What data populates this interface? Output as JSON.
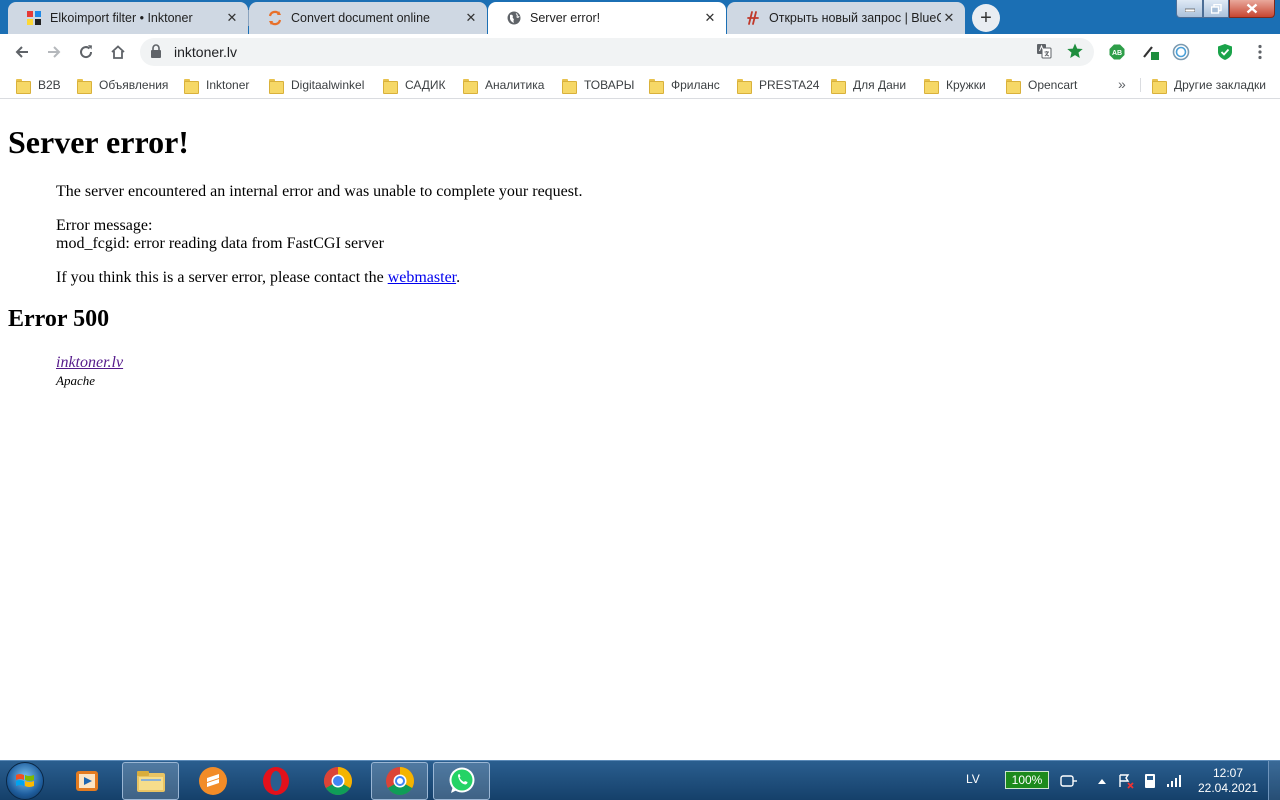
{
  "tabs": [
    {
      "title": "Elkoimport filter • Inktoner",
      "favicon": "inktoner-icon"
    },
    {
      "title": "Convert document online",
      "favicon": "converter-icon"
    },
    {
      "title": "Server error!",
      "favicon": "globe-icon"
    },
    {
      "title": "Открыть новый запрос | BlueCla",
      "favicon": "bluecla-icon"
    }
  ],
  "toolbar": {
    "url": "inktoner.lv"
  },
  "bookmarks": [
    "B2B",
    "Объявления",
    "Inktoner",
    "Digitaalwinkel",
    "САДИК",
    "Аналитика",
    "ТОВАРЫ",
    "Фриланс",
    "PRESTA24",
    "Для Дани",
    "Кружки",
    "Opencart"
  ],
  "bookmarks_more": "»",
  "other_bookmarks": "Другие закладки",
  "page": {
    "title": "Server error!",
    "intro": "The server encountered an internal error and was unable to complete your request.",
    "error_label": "Error message:",
    "error_detail": "mod_fcgid: error reading data from FastCGI server",
    "contact_before": "If you think this is a server error, please contact the ",
    "contact_link": "webmaster",
    "contact_after": ".",
    "error_code": "Error 500",
    "host_link": "inktoner.lv",
    "server_name": "Apache"
  },
  "taskbar": {
    "language": "LV",
    "battery": "100%",
    "time": "12:07",
    "date": "22.04.2021"
  },
  "colors": {
    "tabstrip": "#1b6fb4",
    "link": "#0000ee",
    "visited_link": "#551a8b",
    "taskbar": "#1f4f7e"
  }
}
